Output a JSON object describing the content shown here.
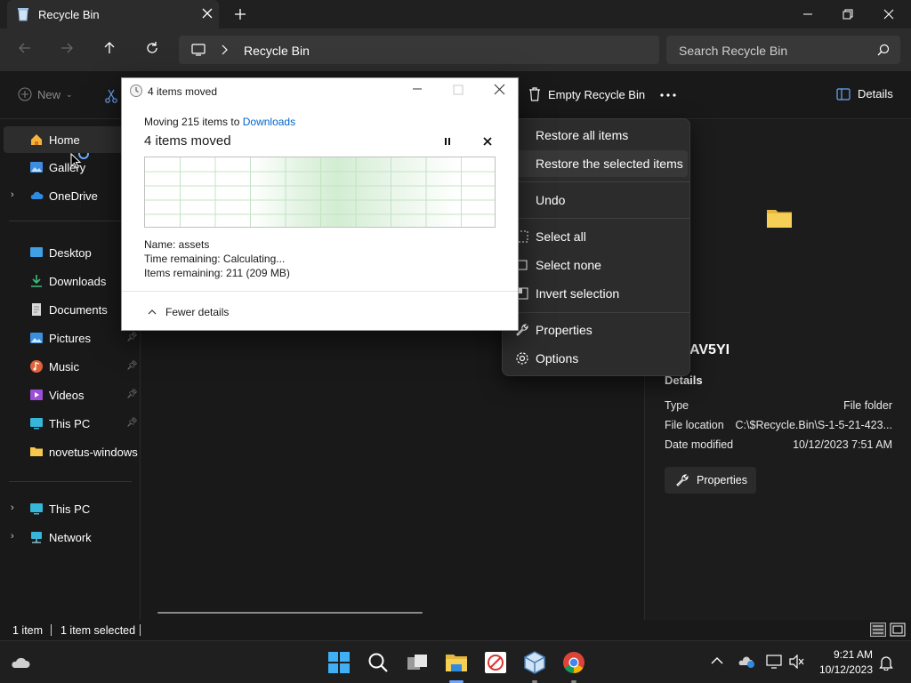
{
  "window": {
    "tab_title": "Recycle Bin",
    "address": "Recycle Bin",
    "search_placeholder": "Search Recycle Bin"
  },
  "command_bar": {
    "new_label": "New",
    "empty_label": "Empty Recycle Bin",
    "details_label": "Details"
  },
  "sidebar": {
    "items": [
      {
        "label": "Home"
      },
      {
        "label": "Gallery"
      },
      {
        "label": "OneDrive"
      },
      {
        "label": "Desktop"
      },
      {
        "label": "Downloads"
      },
      {
        "label": "Documents"
      },
      {
        "label": "Pictures"
      },
      {
        "label": "Music"
      },
      {
        "label": "Videos"
      },
      {
        "label": "This PC"
      },
      {
        "label": "novetus-windows"
      },
      {
        "label": "This PC"
      },
      {
        "label": "Network"
      }
    ]
  },
  "context_menu": {
    "items": [
      {
        "label": "Restore all items"
      },
      {
        "label": "Restore the selected items"
      },
      {
        "label": "Undo"
      },
      {
        "label": "Select all"
      },
      {
        "label": "Select none"
      },
      {
        "label": "Invert selection"
      },
      {
        "label": "Properties"
      },
      {
        "label": "Options"
      }
    ]
  },
  "details_pane": {
    "item_name": "AV5YI",
    "heading": "Details",
    "rows": [
      {
        "label": "Type",
        "value": "File folder"
      },
      {
        "label": "File location",
        "value": "C:\\$Recycle.Bin\\S-1-5-21-423..."
      },
      {
        "label": "Date modified",
        "value": "10/12/2023 7:51 AM"
      }
    ],
    "properties_label": "Properties"
  },
  "status": {
    "count": "1 item",
    "selected": "1 item selected"
  },
  "dialog": {
    "title": "4 items moved",
    "moving_prefix": "Moving 215 items to",
    "destination": "Downloads",
    "heading": "4 items moved",
    "name": "Name:  assets",
    "time_remaining": "Time remaining:  Calculating...",
    "items_remaining": "Items remaining:  211 (209 MB)",
    "fewer_details": "Fewer details"
  },
  "taskbar": {
    "time": "9:21 AM",
    "date": "10/12/2023"
  },
  "colors": {
    "accent": "#0078d4",
    "folder": "#f3c84c"
  }
}
